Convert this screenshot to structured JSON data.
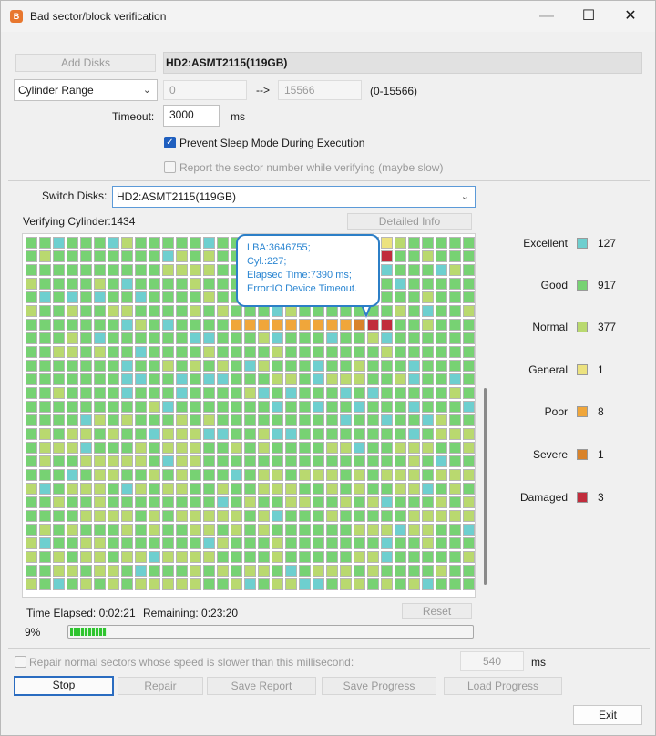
{
  "window": {
    "title": "Bad sector/block verification",
    "icon_text": "B",
    "min_label": "—",
    "max_label": "☐",
    "close_label": "✕"
  },
  "top": {
    "add_disks_label": "Add Disks",
    "disk_title": "HD2:ASMT2115(119GB)",
    "range_mode": "Cylinder Range",
    "range_from": "0",
    "range_arrow": "-->",
    "range_to": "15566",
    "range_hint": "(0-15566)",
    "timeout_label": "Timeout:",
    "timeout_value": "3000",
    "timeout_unit": "ms",
    "prevent_sleep_label": "Prevent Sleep Mode During Execution",
    "prevent_sleep_checked": true,
    "report_sector_label": "Report the sector number while verifying (maybe slow)",
    "report_sector_checked": false
  },
  "switch": {
    "label": "Switch Disks:",
    "value": "HD2:ASMT2115(119GB)"
  },
  "verify": {
    "status": "Verifying Cylinder:1434",
    "detailed_info_label": "Detailed Info"
  },
  "grid": {
    "columns": 33,
    "rows": 26,
    "chevron_icon": "chevron-down-icon"
  },
  "tooltip": {
    "line1": "LBA:3646755;",
    "line2": "Cyl.:227;",
    "line3": "Elapsed Time:7390 ms;",
    "line4": "Error:IO Device Timeout."
  },
  "legend": [
    {
      "name": "Excellent",
      "count": "127",
      "color": "#6ecfcf"
    },
    {
      "name": "Good",
      "count": "917",
      "color": "#77d273"
    },
    {
      "name": "Normal",
      "count": "377",
      "color": "#b9d96f"
    },
    {
      "name": "General",
      "count": "1",
      "color": "#ece27f"
    },
    {
      "name": "Poor",
      "count": "8",
      "color": "#f0a63a"
    },
    {
      "name": "Severe",
      "count": "1",
      "color": "#d9832b"
    },
    {
      "name": "Damaged",
      "count": "3",
      "color": "#c12c3c"
    }
  ],
  "timing": {
    "elapsed": "Time Elapsed:  0:02:21",
    "remaining": "Remaining:  0:23:20",
    "reset_label": "Reset",
    "percent_label": "9%",
    "progress_fraction": 0.09
  },
  "repair": {
    "label": "Repair normal sectors whose speed is slower than this millisecond:",
    "value": "540",
    "unit": "ms",
    "checked": false
  },
  "buttons": {
    "stop": "Stop",
    "repair": "Repair",
    "save_report": "Save Report",
    "save_progress": "Save Progress",
    "load_progress": "Load Progress",
    "exit": "Exit"
  }
}
